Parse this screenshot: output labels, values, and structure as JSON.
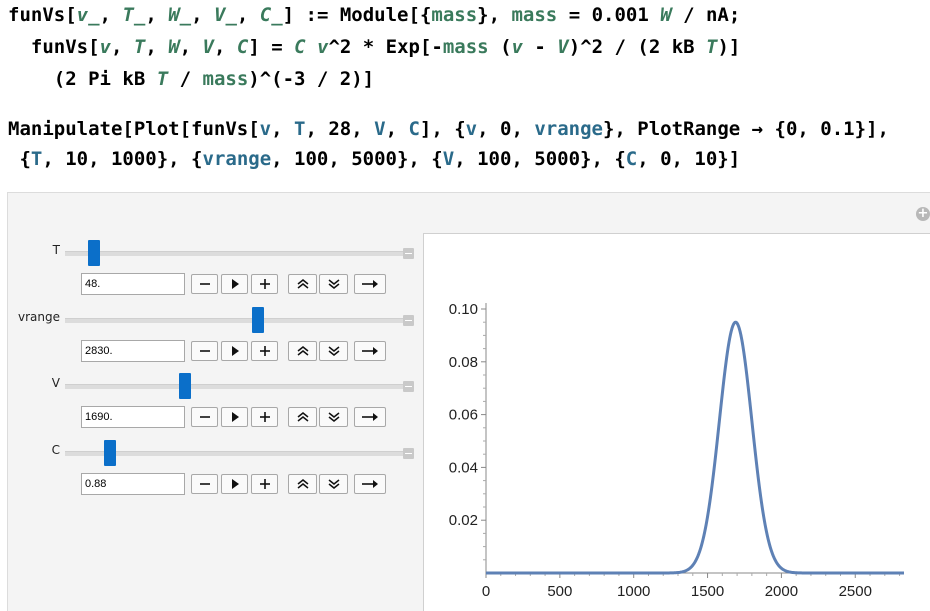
{
  "code": {
    "line1": [
      {
        "t": "funVs",
        "c": "c-blk"
      },
      {
        "t": "[",
        "c": "c-blk"
      },
      {
        "t": "v_",
        "c": "c-ital"
      },
      {
        "t": ", ",
        "c": "c-blk"
      },
      {
        "t": "T_",
        "c": "c-ital"
      },
      {
        "t": ", ",
        "c": "c-blk"
      },
      {
        "t": "W_",
        "c": "c-ital"
      },
      {
        "t": ", ",
        "c": "c-blk"
      },
      {
        "t": "V_",
        "c": "c-ital"
      },
      {
        "t": ", ",
        "c": "c-blk"
      },
      {
        "t": "C_",
        "c": "c-ital"
      },
      {
        "t": "] := Module[{",
        "c": "c-blk"
      },
      {
        "t": "mass",
        "c": "c-grn"
      },
      {
        "t": "}, ",
        "c": "c-blk"
      },
      {
        "t": "mass",
        "c": "c-grn"
      },
      {
        "t": " = 0.001 ",
        "c": "c-blk"
      },
      {
        "t": "W",
        "c": "c-ital"
      },
      {
        "t": " / nA;",
        "c": "c-blk"
      }
    ],
    "line2": [
      {
        "t": "  funVs[",
        "c": "c-blk"
      },
      {
        "t": "v",
        "c": "c-ital"
      },
      {
        "t": ", ",
        "c": "c-blk"
      },
      {
        "t": "T",
        "c": "c-ital"
      },
      {
        "t": ", ",
        "c": "c-blk"
      },
      {
        "t": "W",
        "c": "c-ital"
      },
      {
        "t": ", ",
        "c": "c-blk"
      },
      {
        "t": "V",
        "c": "c-ital"
      },
      {
        "t": ", ",
        "c": "c-blk"
      },
      {
        "t": "C",
        "c": "c-ital"
      },
      {
        "t": "] = ",
        "c": "c-blk"
      },
      {
        "t": "C",
        "c": "c-ital"
      },
      {
        "t": " ",
        "c": "c-blk"
      },
      {
        "t": "v",
        "c": "c-ital"
      },
      {
        "t": "^2 * Exp[-",
        "c": "c-blk"
      },
      {
        "t": "mass",
        "c": "c-grn"
      },
      {
        "t": " (",
        "c": "c-blk"
      },
      {
        "t": "v",
        "c": "c-ital"
      },
      {
        "t": " - ",
        "c": "c-blk"
      },
      {
        "t": "V",
        "c": "c-ital"
      },
      {
        "t": ")^2 / (2 kB ",
        "c": "c-blk"
      },
      {
        "t": "T",
        "c": "c-ital"
      },
      {
        "t": ")]",
        "c": "c-blk"
      }
    ],
    "line3": [
      {
        "t": "    (2 Pi kB ",
        "c": "c-blk"
      },
      {
        "t": "T",
        "c": "c-ital"
      },
      {
        "t": " / ",
        "c": "c-blk"
      },
      {
        "t": "mass",
        "c": "c-grn"
      },
      {
        "t": ")^(-3 / 2)]",
        "c": "c-blk"
      }
    ],
    "line4": [
      {
        "t": "Manipulate[Plot[funVs[",
        "c": "c-blk"
      },
      {
        "t": "v",
        "c": "c-blu"
      },
      {
        "t": ", ",
        "c": "c-blk"
      },
      {
        "t": "T",
        "c": "c-blu"
      },
      {
        "t": ", 28, ",
        "c": "c-blk"
      },
      {
        "t": "V",
        "c": "c-blu"
      },
      {
        "t": ", ",
        "c": "c-blk"
      },
      {
        "t": "C",
        "c": "c-blu"
      },
      {
        "t": "], {",
        "c": "c-blk"
      },
      {
        "t": "v",
        "c": "c-blu"
      },
      {
        "t": ", 0, ",
        "c": "c-blk"
      },
      {
        "t": "vrange",
        "c": "c-blu"
      },
      {
        "t": "}, PlotRange → {0, 0.1}],",
        "c": "c-blk"
      }
    ],
    "line5": [
      {
        "t": " {",
        "c": "c-blk"
      },
      {
        "t": "T",
        "c": "c-blu"
      },
      {
        "t": ", 10, 1000}, {",
        "c": "c-blk"
      },
      {
        "t": "vrange",
        "c": "c-blu"
      },
      {
        "t": ", 100, 5000}, {",
        "c": "c-blk"
      },
      {
        "t": "V",
        "c": "c-blu"
      },
      {
        "t": ", 100, 5000}, {",
        "c": "c-blk"
      },
      {
        "t": "C",
        "c": "c-blu"
      },
      {
        "t": ", 0, 10}]",
        "c": "c-blk"
      }
    ]
  },
  "controls": [
    {
      "label": "T",
      "value": "48.",
      "min": 10,
      "max": 1000,
      "current": 48
    },
    {
      "label": "vrange",
      "value": "2830.",
      "min": 100,
      "max": 5000,
      "current": 2830
    },
    {
      "label": "V",
      "value": "1690.",
      "min": 100,
      "max": 5000,
      "current": 1690
    },
    {
      "label": "C",
      "value": "0.88",
      "min": 0,
      "max": 10,
      "current": 0.88
    }
  ],
  "colors": {
    "thumb": "#0b6fc9",
    "curve": "#5e81b5"
  },
  "icons": [
    "minus-icon",
    "play-icon",
    "plus-icon",
    "faster-icon",
    "slower-icon",
    "arrow-right-icon",
    "minimize-icon",
    "expand-plus-icon"
  ],
  "chart_data": {
    "type": "line",
    "x_ticks": [
      "0",
      "500",
      "1000",
      "1500",
      "2000",
      "2500"
    ],
    "y_ticks": [
      "0.02",
      "0.04",
      "0.06",
      "0.08",
      "0.10"
    ],
    "xlim": [
      0,
      2830
    ],
    "ylim": [
      0,
      0.1
    ],
    "peak": {
      "x": 1690,
      "y": 0.095
    },
    "sigma": 110,
    "x_tick_values": [
      0,
      500,
      1000,
      1500,
      2000,
      2500
    ],
    "y_tick_values": [
      0.02,
      0.04,
      0.06,
      0.08,
      0.1
    ]
  }
}
